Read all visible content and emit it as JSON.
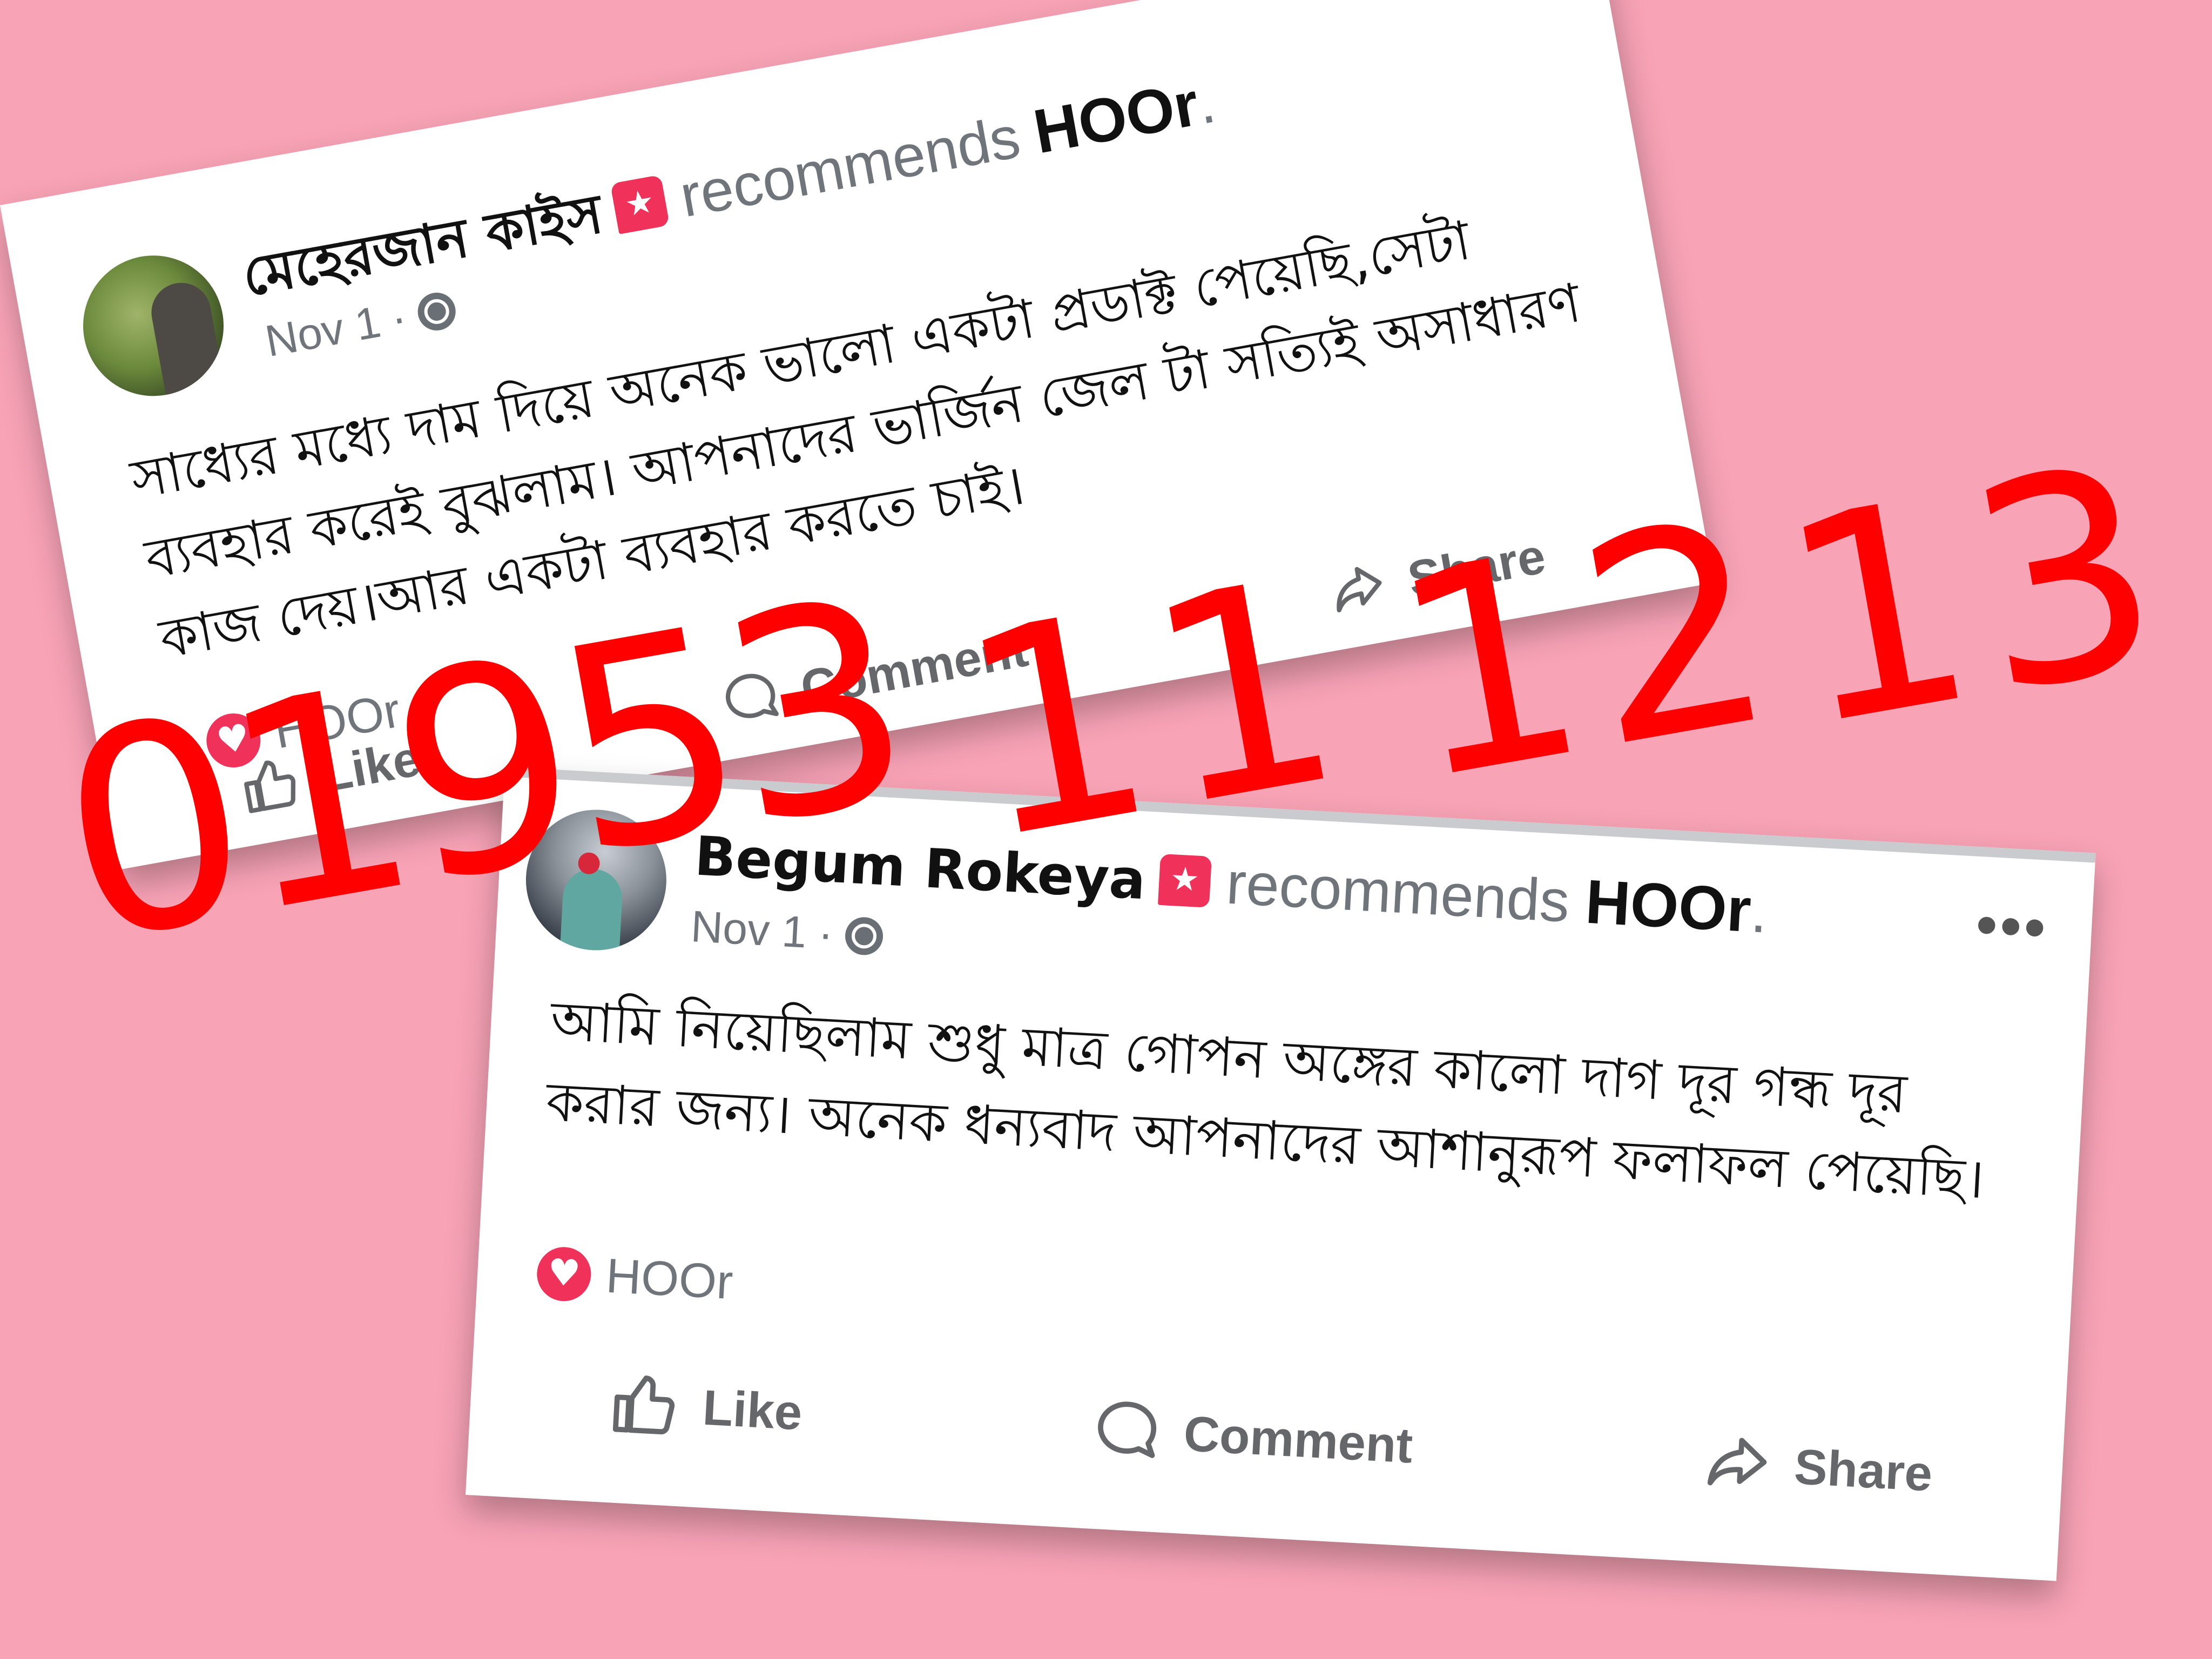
{
  "background_color": "#f8a3b6",
  "accent_color": "#f0315a",
  "overlay_color": "#ff0000",
  "posts": [
    {
      "author": "মেহেরজান কাইস",
      "recommends_text": "recommends",
      "page_name": "HOOr",
      "page_name_suffix": ".",
      "date": "Nov 1",
      "date_separator": "·",
      "privacy_icon": "globe-icon",
      "more_label": "•••",
      "body": "সাধ্যের মধ্যে দাম দিয়ে অনেক ভালো একটা প্রডাক্ট পেয়েছি,সেটা ব্যবহার করেই বুঝলাম। আপনাদের ভার্জিন জেল টা সত্যিই অসাধারণ কাজ দেয়।আর একটা ব্যবহার করতে চাই।",
      "reaction_name": "HOOr",
      "actions": {
        "like": "Like",
        "comment": "Comment",
        "share": "Share"
      }
    },
    {
      "author": "Begum Rokeya",
      "recommends_text": "recommends",
      "page_name": "HOOr",
      "page_name_suffix": ".",
      "date": "Nov 1",
      "date_separator": "·",
      "privacy_icon": "globe-icon",
      "more_label": "•••",
      "body": "আমি নিয়েছিলাম শুধু মাত্র গোপন অঙ্গের কালো দাগ দূর গন্ধ দূর করার জন্য। অনেক ধন্যবাদ আপনাদের আশানুরূপ ফলাফল পেয়েছি।",
      "reaction_name": "HOOr",
      "actions": {
        "like": "Like",
        "comment": "Comment",
        "share": "Share"
      }
    }
  ],
  "phone_overlay": {
    "part1": "01953",
    "part2": "11",
    "part3": "12",
    "part4": "13"
  }
}
